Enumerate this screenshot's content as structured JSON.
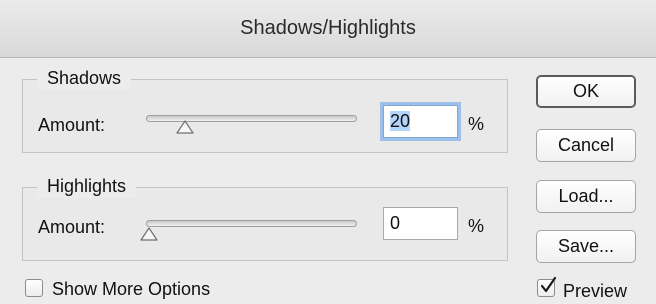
{
  "window": {
    "title": "Shadows/Highlights"
  },
  "shadows": {
    "group_label": "Shadows",
    "amount_label": "Amount:",
    "amount_value": "20",
    "amount_percent": 20,
    "unit": "%"
  },
  "highlights": {
    "group_label": "Highlights",
    "amount_label": "Amount:",
    "amount_value": "0",
    "amount_percent": 0,
    "unit": "%"
  },
  "buttons": {
    "ok": "OK",
    "cancel": "Cancel",
    "load": "Load...",
    "save": "Save..."
  },
  "options": {
    "show_more_label": "Show More Options",
    "show_more_checked": false,
    "preview_label": "Preview",
    "preview_checked": true
  }
}
